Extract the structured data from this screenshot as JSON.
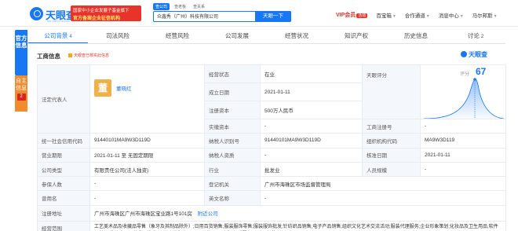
{
  "header": {
    "logo_text": "天眼查",
    "logo_sub": "TianYanCha.com",
    "promo_line1": "国家中小企业发展子基金旗下",
    "promo_line2": "官方备案企业征信机构",
    "search_tabs": [
      "查公司",
      "查老板",
      "查关系"
    ],
    "search_value": "众鑫秀（广州）科技有限公司",
    "search_button": "天眼一下",
    "nav": {
      "vip": "VIP会员",
      "vip_badge": "活动",
      "items": [
        "百宝箱",
        "合作通道",
        "消息中心",
        "马尔邦斯"
      ]
    }
  },
  "side": {
    "blue_tab": "官方信息",
    "orange_tab": "自主信息",
    "orange_count": "2"
  },
  "tabs": [
    {
      "label": "公司背景",
      "count": "4"
    },
    {
      "label": "司法风险",
      "count": ""
    },
    {
      "label": "经营风险",
      "count": ""
    },
    {
      "label": "公司发展",
      "count": ""
    },
    {
      "label": "经营状况",
      "count": ""
    },
    {
      "label": "知识产权",
      "count": ""
    },
    {
      "label": "历史信息",
      "count": ""
    },
    {
      "label": "讨论",
      "count": "2"
    }
  ],
  "section": {
    "title": "工商信息",
    "sub": "天眼查已核实此信息",
    "brand": "天眼查"
  },
  "info": {
    "legal_rep_label": "法定代表人",
    "legal_rep_avatar": "董",
    "legal_rep_name": "董晓红",
    "status_label": "经营状态",
    "status_value": "在业",
    "est_label": "成立日期",
    "est_value": "2021-01-11",
    "reg_cap_label": "注册资本",
    "reg_cap_value": "500万人民币",
    "paid_cap_label": "实缴资本",
    "paid_cap_value": "-",
    "score_label": "天眼评分",
    "score_caption": "评分",
    "score_value": "67",
    "reg_no_label": "工商注册号",
    "reg_no_value": "-",
    "credit_code_label": "统一社会信用代码",
    "credit_code_value": "91440101MA9W3D119D",
    "taxpayer_id_label": "纳税人识别号",
    "taxpayer_id_value": "91440101MA9W3D119D",
    "org_code_label": "组织机构代码",
    "org_code_value": "MA9W3D119",
    "term_label": "营业期限",
    "term_value": "2021-01-11 至 无固定期限",
    "taxpayer_qual_label": "纳税人资质",
    "taxpayer_qual_value": "-",
    "approval_label": "核准日期",
    "approval_value": "2021-01-11",
    "type_label": "公司类型",
    "type_value": "有限责任公司(法人独资)",
    "industry_label": "行业",
    "industry_value": "批发业",
    "staff_label": "人员规模",
    "staff_value": "-",
    "insured_label": "参保人数",
    "insured_value": "-",
    "reg_auth_label": "登记机关",
    "reg_auth_value": "广州市海珠区市场监督管理局",
    "former_label": "曾用名",
    "former_value": "-",
    "en_name_label": "英文名称",
    "en_name_value": "-",
    "address_label": "注册地址",
    "address_value": "广州市海珠区广州市海珠区宝业路1号101房",
    "address_link": "附近公司",
    "scope_label": "经营范围",
    "scope_value": "工艺美术品及收藏品零售（象牙及其制品除外）;日用百货销售;服装服饰零售;服装服饰批发;针纺织品销售;电子产品销售;组织文化艺术交流活动;服装代理服务;企业形象策划;化妆品及卫生用品;软件开发;工艺美术品及收藏品批发;工艺品销售;办公用品销售;工具销售;租赁服务;互联网销售;"
  }
}
